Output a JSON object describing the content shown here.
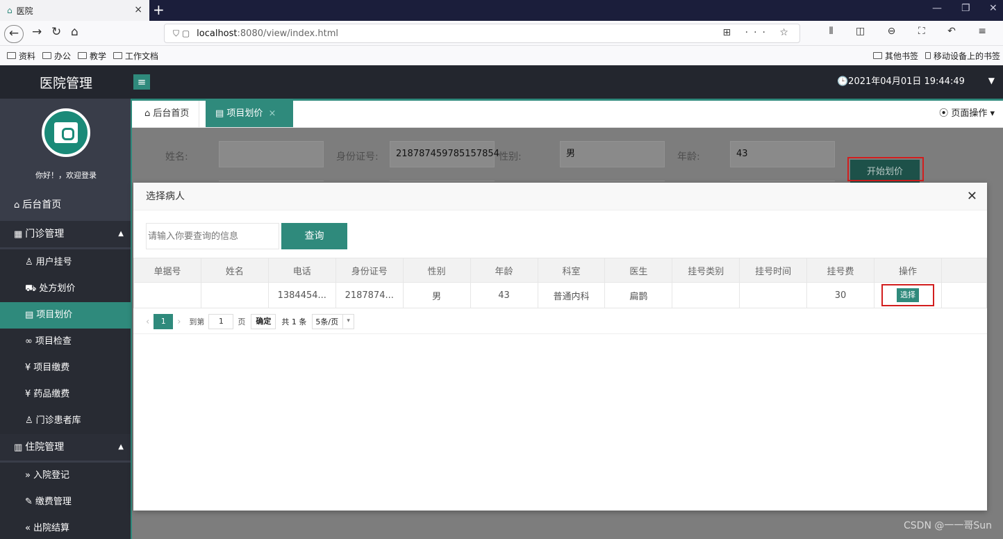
{
  "browser": {
    "tab_title": "医院",
    "tab_close": "×",
    "new_tab": "+",
    "url_host": "localhost",
    "url_path": ":8080/view/index.html",
    "bookmarks": [
      "资料",
      "办公",
      "教学",
      "工作文档"
    ],
    "bookmark_other": "其他书签",
    "bookmark_mobile": "移动设备上的书签"
  },
  "app": {
    "logo": "医院管理",
    "clock": "🕒2021年04月01日 19:44:49",
    "welcome": "你好！，欢迎登录"
  },
  "sidebar": {
    "home": "后台首页",
    "outpatient": "门诊管理",
    "outpatient_items": [
      "用户挂号",
      "处方划价",
      "项目划价",
      "项目检查",
      "项目缴费",
      "药品缴费",
      "门诊患者库"
    ],
    "inpatient": "住院管理",
    "inpatient_items": [
      "入院登记",
      "缴费管理",
      "出院结算"
    ]
  },
  "content_tabs": {
    "home": "后台首页",
    "active": "项目划价",
    "page_ops": "页面操作"
  },
  "form": {
    "name_label": "姓名:",
    "name_value": "",
    "id_label": "身份证号:",
    "id_value": "218787459785157854",
    "gender_label": "性别:",
    "gender_value": "男",
    "age_label": "年龄:",
    "age_value": "43",
    "start_button": "开始划价"
  },
  "modal": {
    "title": "选择病人",
    "search_placeholder": "请输入你要查询的信息",
    "query_button": "查询",
    "columns": [
      "单据号",
      "姓名",
      "电话",
      "身份证号",
      "性别",
      "年龄",
      "科室",
      "医生",
      "挂号类别",
      "挂号时间",
      "挂号费",
      "操作"
    ],
    "rows": [
      [
        "",
        "",
        "1384454...",
        "2187874...",
        "男",
        "43",
        "普通内科",
        "扁鹊",
        "",
        "",
        "30",
        "选择"
      ]
    ],
    "pager": {
      "current_page": "1",
      "goto_label": "到第",
      "goto_value": "1",
      "page_unit": "页",
      "confirm": "确定",
      "total": "共 1 条",
      "page_size": "5条/页"
    }
  },
  "watermark": "CSDN @一一哥Sun"
}
